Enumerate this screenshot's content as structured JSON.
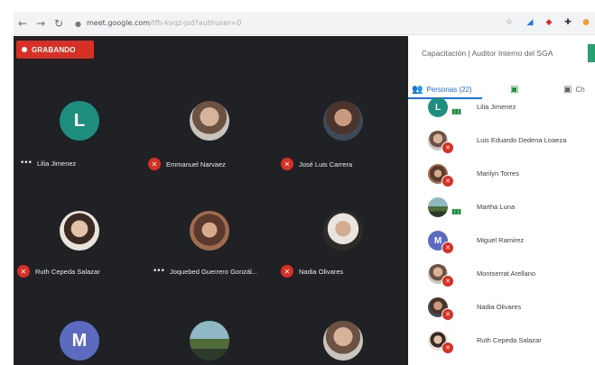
{
  "browser": {
    "url_host": "meet.google.com",
    "url_path": "/tfh-kvqz-jsd?authuser=0",
    "nav_icons": [
      "back-icon",
      "forward-icon",
      "reload-icon"
    ],
    "ext_icons": [
      "star-icon",
      "extension-pin-icon",
      "extension-red-icon",
      "extensions-puzzle-icon",
      "profile-icon"
    ]
  },
  "meet": {
    "recording_label": "GRABANDO",
    "accent_red": "#d93025",
    "tiles": [
      {
        "name": "Lilia Jimenez",
        "initial": "L",
        "avatar_color": "#1e8e7e",
        "state": "speaking"
      },
      {
        "name": "Emmanuel Narvaez",
        "state": "muted"
      },
      {
        "name": "José Luis Carrera",
        "state": "muted"
      },
      {
        "name": "Ruth Cepeda Salazar",
        "state": "muted"
      },
      {
        "name": "Joquebed Guerrero Gonzál...",
        "state": "speaking"
      },
      {
        "name": "Nadia Olivares",
        "state": "muted"
      },
      {
        "name": "",
        "initial": "M",
        "avatar_color": "#5c6bc0"
      },
      {
        "name": ""
      },
      {
        "name": ""
      }
    ]
  },
  "panel": {
    "title": "Capacitación | Auditor Interno del SGA",
    "tabs": [
      {
        "label": "Personas (22)",
        "icon": "people-icon",
        "active": true
      },
      {
        "label": "",
        "icon": "chat-box-icon",
        "active": false
      },
      {
        "label": "Ch",
        "icon": "activities-icon",
        "active": false
      }
    ],
    "people": [
      {
        "name": "Lilia Jimenez",
        "initial": "L",
        "avatar_color": "#1e8e7e",
        "state": "speaking"
      },
      {
        "name": "Luis Eduardo Dedena Loaeza",
        "state": "muted"
      },
      {
        "name": "Marilyn Torres",
        "state": "muted"
      },
      {
        "name": "Martha Luna",
        "state": "speaking"
      },
      {
        "name": "Miguel Ramirez",
        "initial": "M",
        "avatar_color": "#5c6bc0",
        "state": "muted"
      },
      {
        "name": "Montserrat Arellano",
        "state": "muted"
      },
      {
        "name": "Nadia Olivares",
        "state": "muted"
      },
      {
        "name": "Ruth Cepeda Salazar",
        "state": "muted"
      }
    ]
  }
}
